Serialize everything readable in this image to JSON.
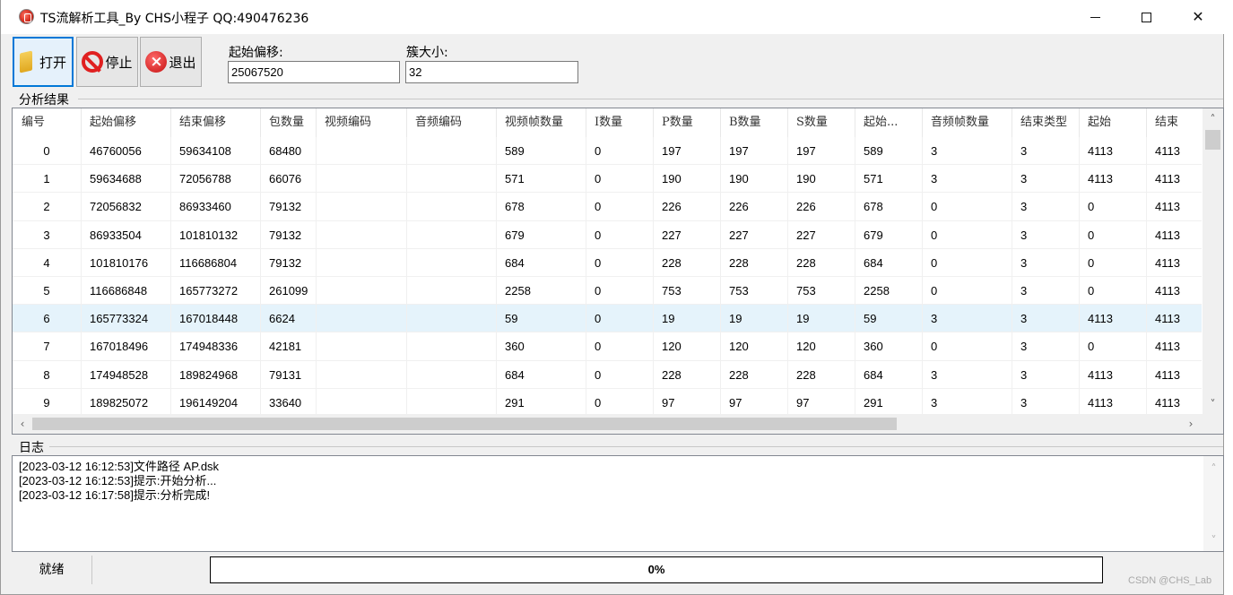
{
  "window": {
    "title": "TS流解析工具_By CHS小程子   QQ:490476236"
  },
  "toolbar": {
    "open_label": "打开",
    "stop_label": "停止",
    "exit_label": "退出",
    "start_offset_label": "起始偏移:",
    "start_offset_value": "25067520",
    "cluster_size_label": "簇大小:",
    "cluster_size_value": "32"
  },
  "results": {
    "group_label": "分析结果",
    "columns": [
      "编号",
      "起始偏移",
      "结束偏移",
      "包数量",
      "视频编码",
      "音频编码",
      "视频帧数量",
      "I数量",
      "P数量",
      "B数量",
      "S数量",
      "起始...",
      "音频帧数量",
      "结束类型",
      "起始",
      "结束"
    ],
    "rows": [
      [
        "0",
        "46760056",
        "59634108",
        "68480",
        "",
        "",
        "589",
        "0",
        "197",
        "197",
        "197",
        "589",
        "3",
        "3",
        "4113",
        "4113"
      ],
      [
        "1",
        "59634688",
        "72056788",
        "66076",
        "",
        "",
        "571",
        "0",
        "190",
        "190",
        "190",
        "571",
        "3",
        "3",
        "4113",
        "4113"
      ],
      [
        "2",
        "72056832",
        "86933460",
        "79132",
        "",
        "",
        "678",
        "0",
        "226",
        "226",
        "226",
        "678",
        "0",
        "3",
        "0",
        "4113"
      ],
      [
        "3",
        "86933504",
        "101810132",
        "79132",
        "",
        "",
        "679",
        "0",
        "227",
        "227",
        "227",
        "679",
        "0",
        "3",
        "0",
        "4113"
      ],
      [
        "4",
        "101810176",
        "116686804",
        "79132",
        "",
        "",
        "684",
        "0",
        "228",
        "228",
        "228",
        "684",
        "0",
        "3",
        "0",
        "4113"
      ],
      [
        "5",
        "116686848",
        "165773272",
        "261099",
        "",
        "",
        "2258",
        "0",
        "753",
        "753",
        "753",
        "2258",
        "0",
        "3",
        "0",
        "4113"
      ],
      [
        "6",
        "165773324",
        "167018448",
        "6624",
        "",
        "",
        "59",
        "0",
        "19",
        "19",
        "19",
        "59",
        "3",
        "3",
        "4113",
        "4113"
      ],
      [
        "7",
        "167018496",
        "174948336",
        "42181",
        "",
        "",
        "360",
        "0",
        "120",
        "120",
        "120",
        "360",
        "0",
        "3",
        "0",
        "4113"
      ],
      [
        "8",
        "174948528",
        "189824968",
        "79131",
        "",
        "",
        "684",
        "0",
        "228",
        "228",
        "228",
        "684",
        "3",
        "3",
        "4113",
        "4113"
      ],
      [
        "9",
        "189825072",
        "196149204",
        "33640",
        "",
        "",
        "291",
        "0",
        "97",
        "97",
        "97",
        "291",
        "3",
        "3",
        "4113",
        "4113"
      ]
    ],
    "selected_row": 6
  },
  "log": {
    "group_label": "日志",
    "lines": [
      "[2023-03-12 16:12:53]文件路径                                           AP.dsk",
      "[2023-03-12 16:12:53]提示:开始分析...",
      "[2023-03-12 16:17:58]提示:分析完成!"
    ]
  },
  "status": {
    "ready_text": "就绪",
    "progress_text": "0%",
    "progress_value": 0
  },
  "watermark": "CSDN @CHS_Lab",
  "colors": {
    "selection": "#e5f3fb",
    "accent": "#0078d7",
    "progress_fill": "#06b025"
  }
}
